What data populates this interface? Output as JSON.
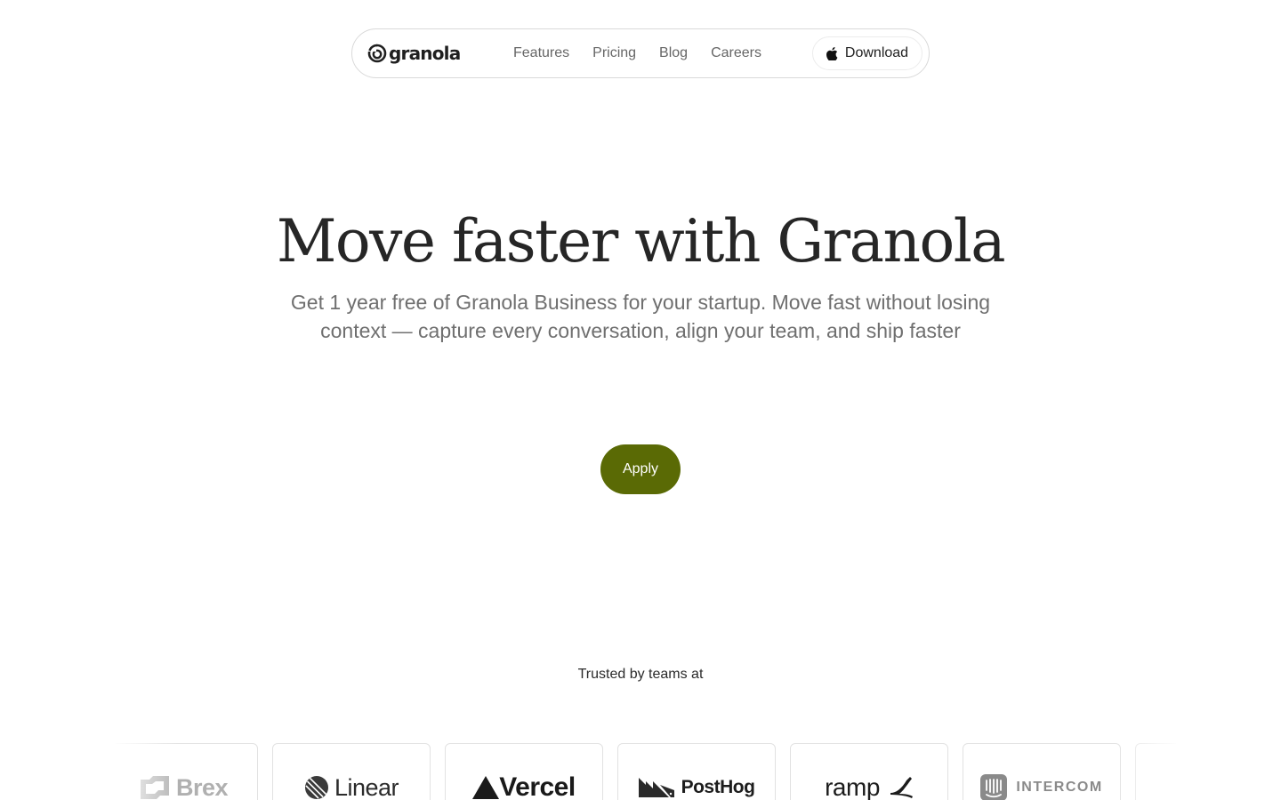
{
  "nav": {
    "logo_text": "granola",
    "links": [
      "Features",
      "Pricing",
      "Blog",
      "Careers"
    ],
    "download_label": "Download"
  },
  "hero": {
    "title": "Move faster with Granola",
    "subtitle_line1": "Get 1 year free of Granola Business for your startup. Move fast without losing",
    "subtitle_line2": "context — capture every conversation, align your team, and ship faster",
    "apply_label": "Apply"
  },
  "trusted": {
    "label": "Trusted by teams at",
    "logos": [
      "Brex",
      "Linear",
      "Vercel",
      "PostHog",
      "ramp",
      "INTERCOM"
    ]
  },
  "colors": {
    "accent": "#5a6a05",
    "text_dark": "#262626",
    "text_muted": "#6f6f6f",
    "border": "#d9d9d9"
  },
  "icons": {
    "logo": "granola-swirl-icon",
    "download": "apple-icon"
  }
}
